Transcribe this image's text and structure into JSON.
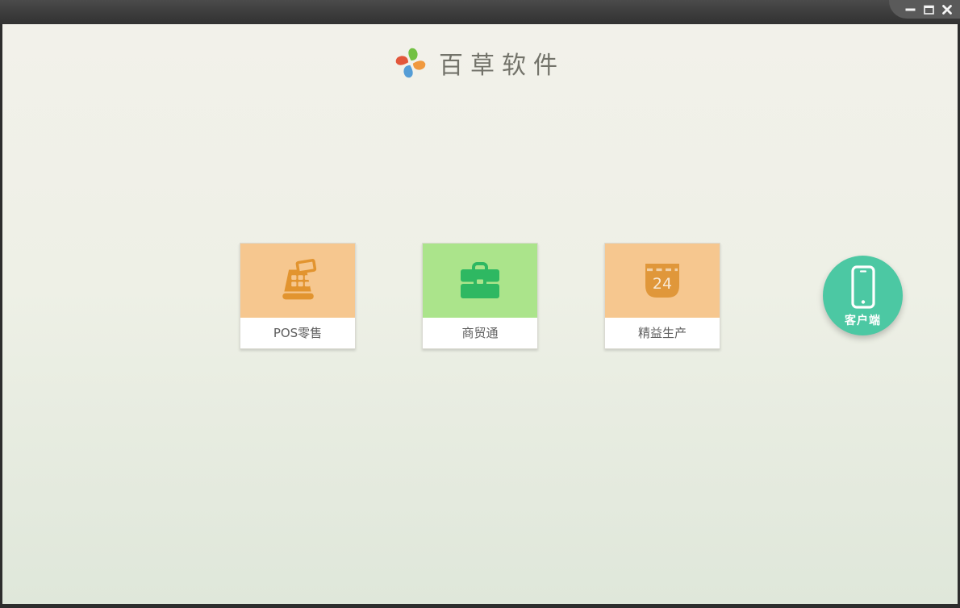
{
  "window": {
    "controls": {
      "minimize": "minimize-icon",
      "maximize": "maximize-icon",
      "close": "close-icon"
    },
    "titlebar_color": "#3c3c3c",
    "frame_color": "#2d2d2d"
  },
  "header": {
    "app_title": "百草软件",
    "logo": "pinwheel-logo",
    "logo_colors": [
      "#72c143",
      "#f0993e",
      "#549dd6",
      "#e2573b"
    ]
  },
  "products": [
    {
      "label": "POS零售",
      "icon": "cash-register-icon",
      "tile_color": "#f6c78f",
      "icon_color": "#e2942f"
    },
    {
      "label": "商贸通",
      "icon": "briefcase-icon",
      "tile_color": "#abe48b",
      "icon_color": "#2eb862"
    },
    {
      "label": "精益生产",
      "icon": "calendar-icon",
      "tile_color": "#f6c78f",
      "icon_color": "#e0973a",
      "calendar_day": "24"
    }
  ],
  "client": {
    "label": "客户端",
    "icon": "smartphone-icon",
    "color": "#4cc8a3"
  },
  "background": {
    "top": "#f2f1ea",
    "bottom": "#dfe7da"
  }
}
